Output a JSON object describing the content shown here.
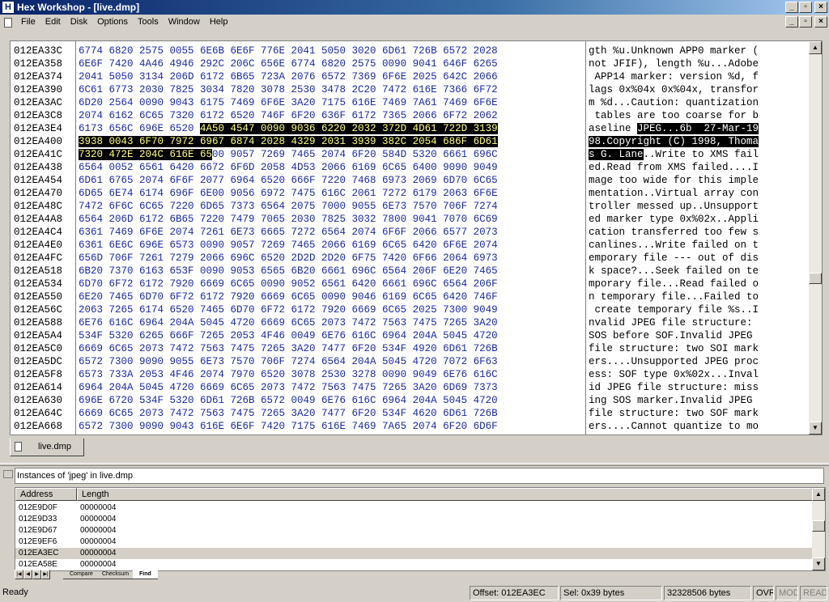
{
  "window": {
    "title": "Hex Workshop - [live.dmp]",
    "app_icon": "H"
  },
  "menus": [
    "File",
    "Edit",
    "Disk",
    "Options",
    "Tools",
    "Window",
    "Help"
  ],
  "hex_rows": [
    {
      "addr": "012EA33C",
      "hex": "6774 6820 2575 0055 6E6B 6E6F 776E 2041 5050 3020 6D61 726B 6572 2028",
      "asc": "gth %u.Unknown APP0 marker ("
    },
    {
      "addr": "012EA358",
      "hex": "6E6F 7420 4A46 4946 292C 206C 656E 6774 6820 2575 0090 9041 646F 6265",
      "asc": "not JFIF), length %u...Adobe"
    },
    {
      "addr": "012EA374",
      "hex": "2041 5050 3134 206D 6172 6B65 723A 2076 6572 7369 6F6E 2025 642C 2066",
      "asc": " APP14 marker: version %d, f"
    },
    {
      "addr": "012EA390",
      "hex": "6C61 6773 2030 7825 3034 7820 3078 2530 3478 2C20 7472 616E 7366 6F72",
      "asc": "lags 0x%04x 0x%04x, transfor"
    },
    {
      "addr": "012EA3AC",
      "hex": "6D20 2564 0090 9043 6175 7469 6F6E 3A20 7175 616E 7469 7A61 7469 6F6E",
      "asc": "m %d...Caution: quantization"
    },
    {
      "addr": "012EA3C8",
      "hex": "2074 6162 6C65 7320 6172 6520 746F 6F20 636F 6172 7365 2066 6F72 2062",
      "asc": " tables are too coarse for b"
    },
    {
      "addr": "012EA3E4",
      "hex_a": "6173 656C 696E 6520 ",
      "hex_s": "4A50 4547 0090 9036 6220 2032 372D 4D61 722D 3139",
      "asc_a": "aseline ",
      "asc_s": "JPEG...6b  27-Mar-19"
    },
    {
      "addr": "012EA400",
      "hex_s": "3938 0043 6F70 7972 6967 6874 2028 4329 2031 3939 382C 2054 686F 6D61",
      "asc_s": "98.Copyright (C) 1998, Thoma"
    },
    {
      "addr": "012EA41C",
      "hex_s": "7320 472E 204C 616E 65",
      "hex_b": "00 9057 7269 7465 2074 6F20 584D 5320 6661 696C",
      "asc_s": "s G. Lane",
      "asc_b": "..Write to XMS fail"
    },
    {
      "addr": "012EA438",
      "hex": "6564 0052 6561 6420 6672 6F6D 2058 4D53 2066 6169 6C65 6400 9090 9049",
      "asc": "ed.Read from XMS failed....I"
    },
    {
      "addr": "012EA454",
      "hex": "6D61 6765 2074 6F6F 2077 6964 6520 666F 7220 7468 6973 2069 6D70 6C65",
      "asc": "mage too wide for this imple"
    },
    {
      "addr": "012EA470",
      "hex": "6D65 6E74 6174 696F 6E00 9056 6972 7475 616C 2061 7272 6179 2063 6F6E",
      "asc": "mentation..Virtual array con"
    },
    {
      "addr": "012EA48C",
      "hex": "7472 6F6C 6C65 7220 6D65 7373 6564 2075 7000 9055 6E73 7570 706F 7274",
      "asc": "troller messed up..Unsupport"
    },
    {
      "addr": "012EA4A8",
      "hex": "6564 206D 6172 6B65 7220 7479 7065 2030 7825 3032 7800 9041 7070 6C69",
      "asc": "ed marker type 0x%02x..Appli"
    },
    {
      "addr": "012EA4C4",
      "hex": "6361 7469 6F6E 2074 7261 6E73 6665 7272 6564 2074 6F6F 2066 6577 2073",
      "asc": "cation transferred too few s"
    },
    {
      "addr": "012EA4E0",
      "hex": "6361 6E6C 696E 6573 0090 9057 7269 7465 2066 6169 6C65 6420 6F6E 2074",
      "asc": "canlines...Write failed on t"
    },
    {
      "addr": "012EA4FC",
      "hex": "656D 706F 7261 7279 2066 696C 6520 2D2D 2D20 6F75 7420 6F66 2064 6973",
      "asc": "emporary file --- out of dis"
    },
    {
      "addr": "012EA518",
      "hex": "6B20 7370 6163 653F 0090 9053 6565 6B20 6661 696C 6564 206F 6E20 7465",
      "asc": "k space?...Seek failed on te"
    },
    {
      "addr": "012EA534",
      "hex": "6D70 6F72 6172 7920 6669 6C65 0090 9052 6561 6420 6661 696C 6564 206F",
      "asc": "mporary file...Read failed o"
    },
    {
      "addr": "012EA550",
      "hex": "6E20 7465 6D70 6F72 6172 7920 6669 6C65 0090 9046 6169 6C65 6420 746F",
      "asc": "n temporary file...Failed to"
    },
    {
      "addr": "012EA56C",
      "hex": "2063 7265 6174 6520 7465 6D70 6F72 6172 7920 6669 6C65 2025 7300 9049",
      "asc": " create temporary file %s..I"
    },
    {
      "addr": "012EA588",
      "hex": "6E76 616C 6964 204A 5045 4720 6669 6C65 2073 7472 7563 7475 7265 3A20",
      "asc": "nvalid JPEG file structure: "
    },
    {
      "addr": "012EA5A4",
      "hex": "534F 5320 6265 666F 7265 2053 4F46 0049 6E76 616C 6964 204A 5045 4720",
      "asc": "SOS before SOF.Invalid JPEG "
    },
    {
      "addr": "012EA5C0",
      "hex": "6669 6C65 2073 7472 7563 7475 7265 3A20 7477 6F20 534F 4920 6D61 726B",
      "asc": "file structure: two SOI mark"
    },
    {
      "addr": "012EA5DC",
      "hex": "6572 7300 9090 9055 6E73 7570 706F 7274 6564 204A 5045 4720 7072 6F63",
      "asc": "ers....Unsupported JPEG proc"
    },
    {
      "addr": "012EA5F8",
      "hex": "6573 733A 2053 4F46 2074 7970 6520 3078 2530 3278 0090 9049 6E76 616C",
      "asc": "ess: SOF type 0x%02x...Inval"
    },
    {
      "addr": "012EA614",
      "hex": "6964 204A 5045 4720 6669 6C65 2073 7472 7563 7475 7265 3A20 6D69 7373",
      "asc": "id JPEG file structure: miss"
    },
    {
      "addr": "012EA630",
      "hex": "696E 6720 534F 5320 6D61 726B 6572 0049 6E76 616C 6964 204A 5045 4720",
      "asc": "ing SOS marker.Invalid JPEG "
    },
    {
      "addr": "012EA64C",
      "hex": "6669 6C65 2073 7472 7563 7475 7265 3A20 7477 6F20 534F 4620 6D61 726B",
      "asc": "file structure: two SOF mark"
    },
    {
      "addr": "012EA668",
      "hex": "6572 7300 9090 9043 616E 6E6F 7420 7175 616E 7469 7A65 2074 6F20 6D6F",
      "asc": "ers....Cannot quantize to mo"
    }
  ],
  "doc_tab": {
    "label": "live.dmp"
  },
  "find_panel": {
    "title": "Instances of 'jpeg' in live.dmp",
    "col_address": "Address",
    "col_length": "Length",
    "results": [
      {
        "address": "012E9D0F",
        "length": "00000004"
      },
      {
        "address": "012E9D33",
        "length": "00000004"
      },
      {
        "address": "012E9D67",
        "length": "00000004"
      },
      {
        "address": "012E9EF6",
        "length": "00000004"
      },
      {
        "address": "012EA3EC",
        "length": "00000004"
      },
      {
        "address": "012EA58E",
        "length": "00000004"
      }
    ],
    "tabs": [
      "Compare",
      "Checksum",
      "Find"
    ],
    "active_tab": "Find"
  },
  "status": {
    "ready": "Ready",
    "offset": "Offset: 012EA3EC",
    "sel": "Sel: 0x39 bytes",
    "size": "32328506 bytes",
    "ovr": "OVR",
    "mod": "MOD",
    "read": "READ"
  },
  "colors": {
    "hex_text": "#1b2aa0",
    "selection_bg": "#000000",
    "selection_text": "#ffff80",
    "title_start": "#0a246a"
  }
}
